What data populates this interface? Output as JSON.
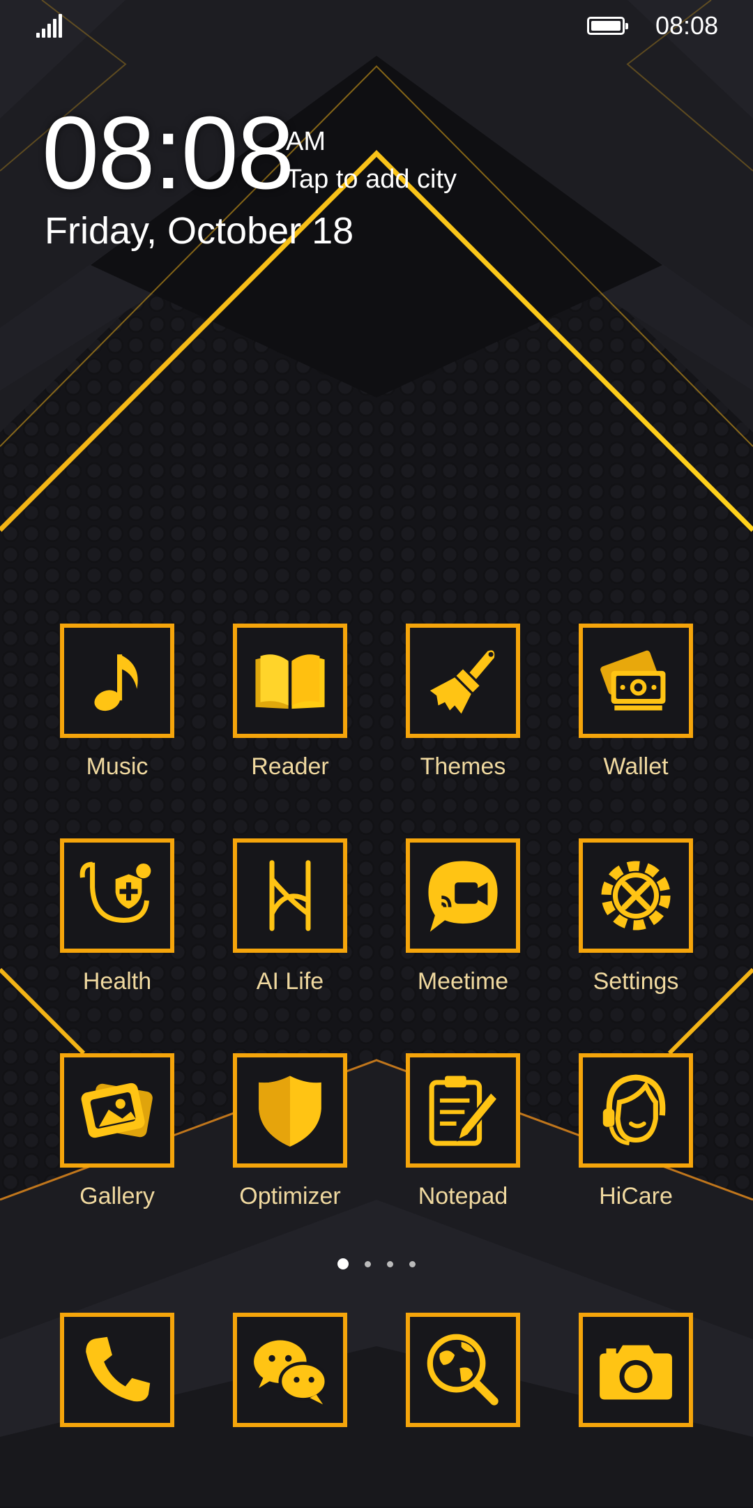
{
  "status_bar": {
    "time": "08:08",
    "signal_icon": "signal-bars-icon",
    "battery_icon": "battery-full-icon"
  },
  "clock_widget": {
    "time": "08:08",
    "ampm": "AM",
    "city": "Tap to add city",
    "date": "Friday, October 18"
  },
  "theme": {
    "accent": "#f5a50b",
    "label_color": "#f0d9a0",
    "background": "#141418"
  },
  "apps": [
    {
      "label": "Music",
      "icon": "music-note-icon"
    },
    {
      "label": "Reader",
      "icon": "book-icon"
    },
    {
      "label": "Themes",
      "icon": "paintbrush-icon"
    },
    {
      "label": "Wallet",
      "icon": "wallet-cash-icon"
    },
    {
      "label": "Health",
      "icon": "stethoscope-icon"
    },
    {
      "label": "AI Life",
      "icon": "ai-life-icon"
    },
    {
      "label": "Meetime",
      "icon": "video-call-bubble-icon"
    },
    {
      "label": "Settings",
      "icon": "gear-tools-icon"
    },
    {
      "label": "Gallery",
      "icon": "photos-icon"
    },
    {
      "label": "Optimizer",
      "icon": "shield-icon"
    },
    {
      "label": "Notepad",
      "icon": "clipboard-pencil-icon"
    },
    {
      "label": "HiCare",
      "icon": "headset-support-icon"
    }
  ],
  "dock": [
    {
      "icon": "phone-icon"
    },
    {
      "icon": "wechat-bubbles-icon"
    },
    {
      "icon": "globe-search-icon"
    },
    {
      "icon": "camera-icon"
    }
  ],
  "pages": {
    "count": 4,
    "active": 1
  }
}
